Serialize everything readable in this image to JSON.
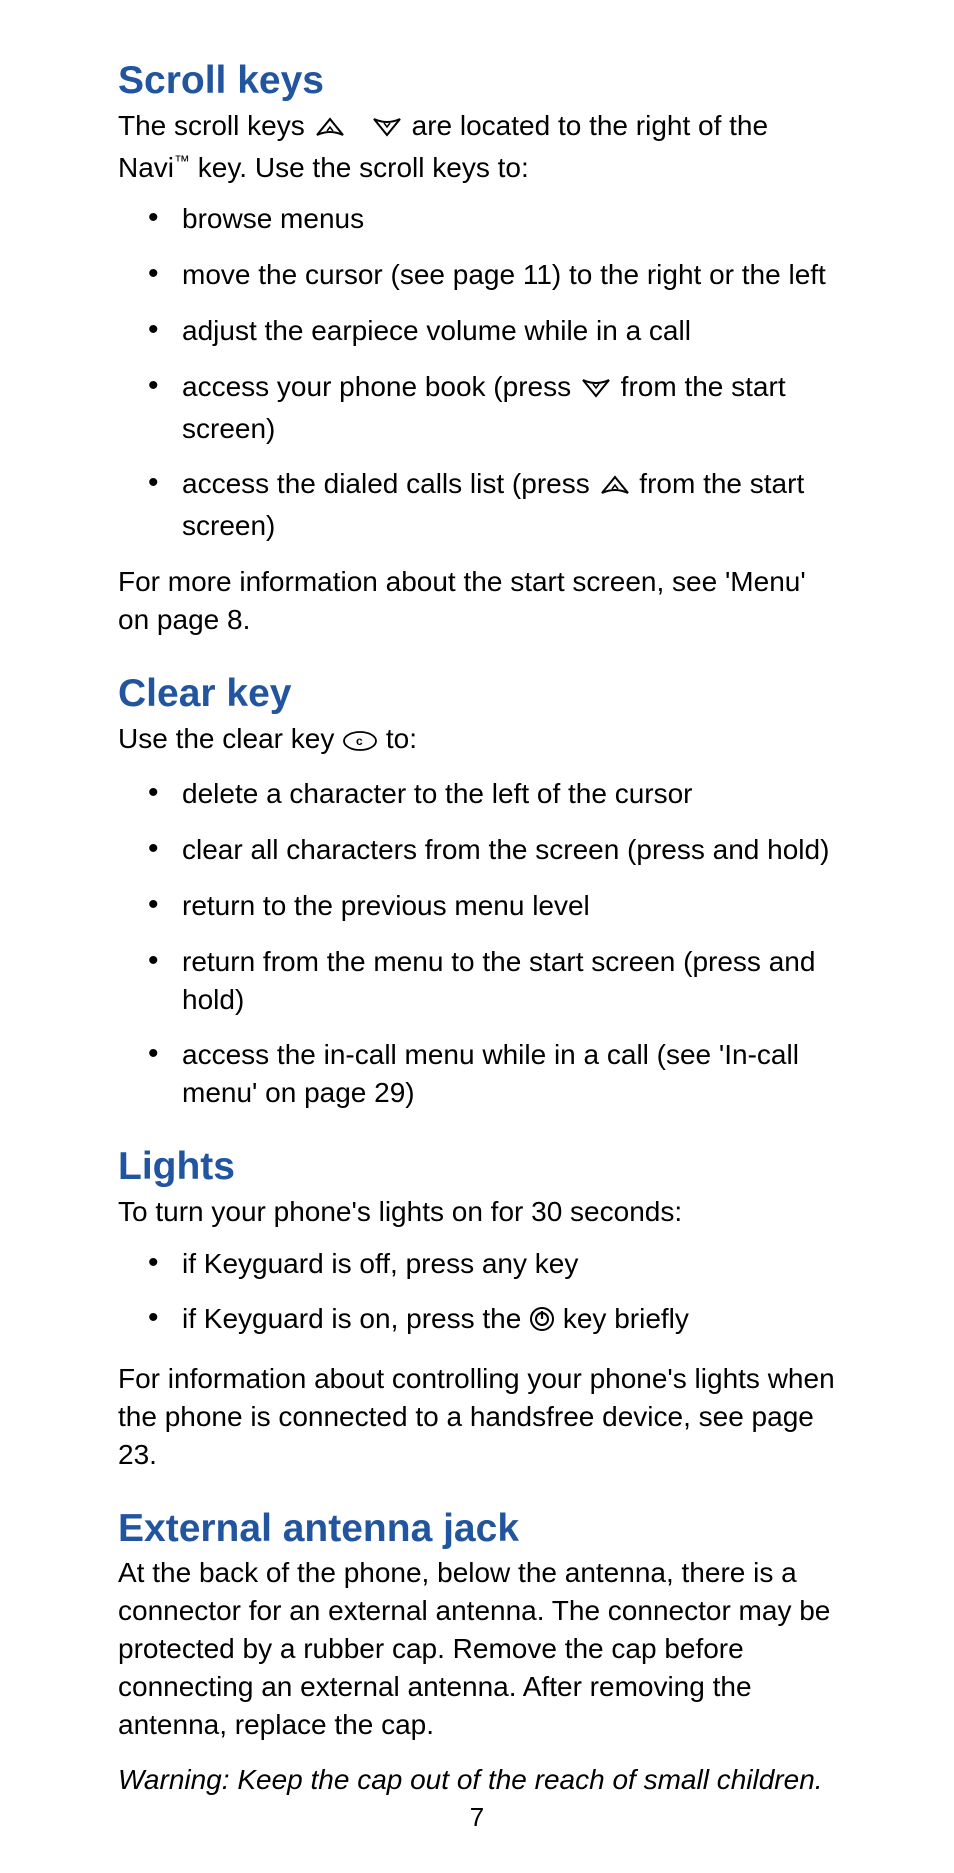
{
  "sections": {
    "scroll": {
      "heading": "Scroll keys",
      "intro_a": "The scroll keys ",
      "intro_b": " are located to the right of the Navi",
      "intro_tm": "™",
      "intro_c": " key. Use the scroll keys to:",
      "bullets": {
        "b1": "browse menus",
        "b2": "move the cursor (see page 11) to the right or the left",
        "b3": "adjust the earpiece volume while in a call",
        "b4a": "access your phone book (press ",
        "b4b": " from the start screen)",
        "b5a": "access the dialed calls list (press ",
        "b5b": " from the start screen)"
      },
      "outro": "For more information about the start screen, see 'Menu' on page 8."
    },
    "clear": {
      "heading": "Clear key",
      "intro_a": "Use the clear key ",
      "intro_b": " to:",
      "bullets": {
        "b1": "delete a character to the left of the cursor",
        "b2": "clear all characters from the screen (press and hold)",
        "b3": "return to the previous menu level",
        "b4": "return from the menu to the start screen (press and hold)",
        "b5": "access the in-call menu while in a call (see 'In-call menu' on page 29)"
      }
    },
    "lights": {
      "heading": "Lights",
      "intro": "To turn your phone's lights on for 30 seconds:",
      "bullets": {
        "b1": "if Keyguard is off, press any key",
        "b2a": "if Keyguard is on, press the ",
        "b2b": " key briefly"
      },
      "outro": "For information about controlling your phone's lights when the phone is connected to a handsfree device, see page 23."
    },
    "antenna": {
      "heading": "External antenna jack",
      "body": "At the back of the phone, below the antenna, there is a connector for an external antenna. The connector may be protected by a rubber cap. Remove the cap before connecting an external antenna. After removing the antenna, replace the cap.",
      "warning": "Warning:  Keep the cap out of the reach of small children."
    }
  },
  "page_number": "7"
}
